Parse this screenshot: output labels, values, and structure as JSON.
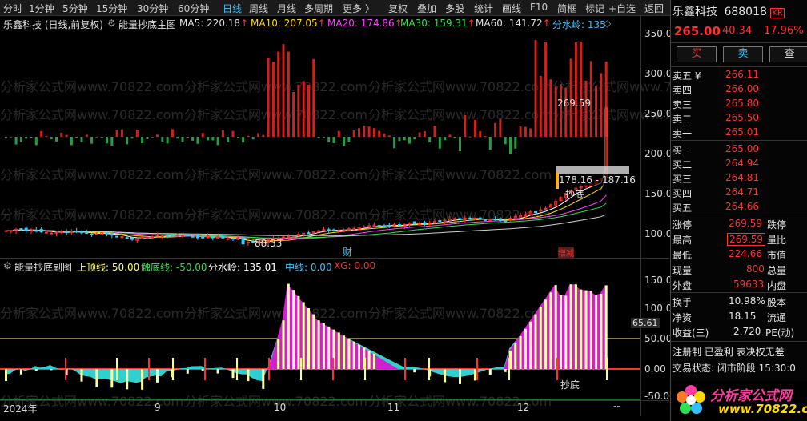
{
  "toolbar": {
    "periods": [
      "分时",
      "1分钟",
      "5分钟",
      "15分钟",
      "30分钟",
      "60分钟",
      "日线",
      "周线",
      "月线",
      "多周期",
      "更多 〉"
    ],
    "active_period": "日线",
    "tools": [
      "复权",
      "叠加",
      "多股",
      "统计",
      "画线",
      "F10",
      "简框",
      "标记",
      "+自选",
      "返回"
    ]
  },
  "main_chart": {
    "stock_label": "乐鑫科技 (日线,前复权)",
    "indicator_name": "能量抄底主图",
    "ma": [
      {
        "name": "MA5",
        "value": "220.18",
        "color": "#ffffff"
      },
      {
        "name": "MA10",
        "value": "207.05",
        "color": "#ffd800"
      },
      {
        "name": "MA20",
        "value": "174.86",
        "color": "#ff40ff"
      },
      {
        "name": "MA30",
        "value": "159.31",
        "color": "#30e050"
      },
      {
        "name": "MA60",
        "value": "141.72",
        "color": "#e0e0e0"
      }
    ],
    "fenshuiling_label": "分水岭: 135",
    "y_ticks": [
      "350.0",
      "300.0",
      "250.0",
      "200.0",
      "150.0",
      "100.0"
    ],
    "annotations": {
      "high": "269.59",
      "low": "88.33",
      "range": "178.16 - 187.16",
      "chaodi": "抄底",
      "cai": "财",
      "mark": "增减"
    }
  },
  "sub_chart": {
    "name": "能量抄底副图",
    "lines": [
      {
        "label": "上顶线: 50.00",
        "color": "#ffff66"
      },
      {
        "label": "触底线: -50.00",
        "color": "#30e050"
      },
      {
        "label": "分水岭: 135.01",
        "color": "#ffffff"
      },
      {
        "label": "中线: 0.00",
        "color": "#35c1ff"
      },
      {
        "label": "XG: 0.00",
        "color": "#ff3030"
      }
    ],
    "y_ticks": [
      "150.0",
      "100.0",
      "50.00",
      "0.00",
      "-50.00"
    ],
    "cursor_value": "65.61",
    "chaodi": "抄底"
  },
  "x_axis": [
    "2024年",
    "9",
    "10",
    "11",
    "12"
  ],
  "quote": {
    "name": "乐鑫科技",
    "code": "688018",
    "badge": "KR",
    "price": "265.00",
    "change": "40.34",
    "pct": "17.96%",
    "buttons": [
      "买",
      "卖",
      "查"
    ],
    "sells": [
      {
        "k": "卖五 ¥",
        "v": "266.11"
      },
      {
        "k": "卖四",
        "v": "266.00"
      },
      {
        "k": "卖三",
        "v": "265.80"
      },
      {
        "k": "卖二",
        "v": "265.50"
      },
      {
        "k": "卖一",
        "v": "265.01"
      }
    ],
    "buys": [
      {
        "k": "买一",
        "v": "265.00"
      },
      {
        "k": "买二",
        "v": "264.94"
      },
      {
        "k": "买三",
        "v": "264.81"
      },
      {
        "k": "买四",
        "v": "264.71"
      },
      {
        "k": "买五",
        "v": "264.66"
      }
    ],
    "stats": [
      {
        "k": "涨停",
        "v": "269.59",
        "k2": "跌停",
        "color": "red"
      },
      {
        "k": "最高",
        "v": "269.59",
        "k2": "量比",
        "color": "red",
        "boxed": true
      },
      {
        "k": "最低",
        "v": "224.66",
        "k2": "市值",
        "color": "red"
      },
      {
        "k": "现量",
        "v": "800",
        "k2": "总量",
        "color": "red"
      },
      {
        "k": "外盘",
        "v": "59633",
        "k2": "内盘",
        "color": "red"
      },
      {
        "k": "换手",
        "v": "10.98%",
        "k2": "股本",
        "color": "white"
      },
      {
        "k": "净资",
        "v": "18.15",
        "k2": "流通",
        "color": "white"
      },
      {
        "k": "收益(三)",
        "v": "2.720",
        "k2": "PE(动)",
        "color": "white"
      }
    ],
    "footer1": "注册制 已盈利 表决权无差",
    "footer2": "交易状态: 闭市阶段 15:30:0"
  },
  "watermark": "分析家公式网www.70822.com",
  "logo": {
    "text": "分析家公式网",
    "url": "www.70822.com"
  }
}
